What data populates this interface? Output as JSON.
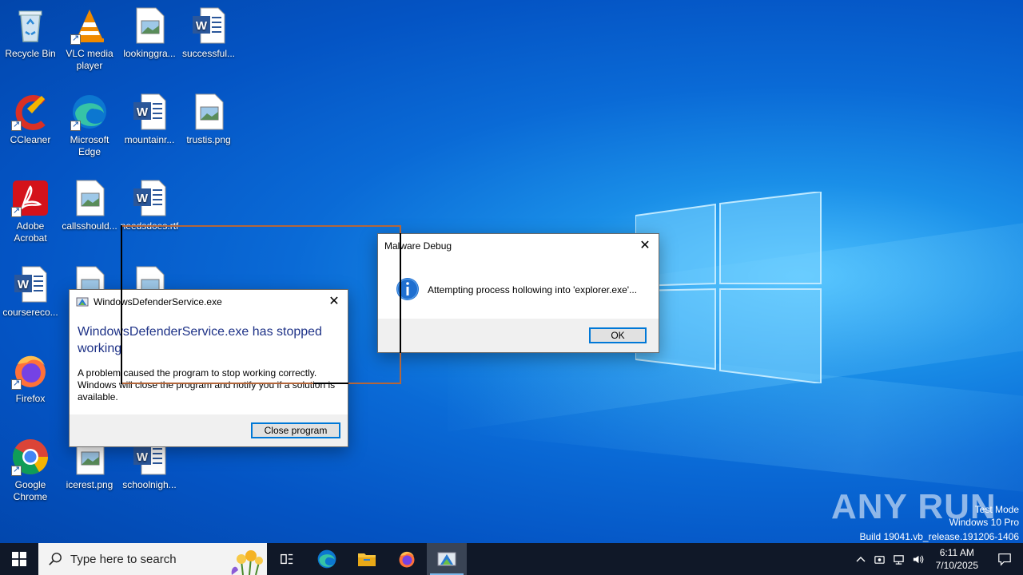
{
  "desktop": {
    "icons": [
      {
        "label": "Recycle Bin",
        "icon": "recycle-bin-icon"
      },
      {
        "label": "VLC media player",
        "icon": "vlc-icon"
      },
      {
        "label": "lookinggra...",
        "icon": "image-file-icon"
      },
      {
        "label": "successful...",
        "icon": "word-doc-icon"
      },
      {
        "label": "CCleaner",
        "icon": "ccleaner-icon"
      },
      {
        "label": "Microsoft Edge",
        "icon": "edge-icon"
      },
      {
        "label": "mountainr...",
        "icon": "word-doc-icon"
      },
      {
        "label": "trustis.png",
        "icon": "image-file-icon"
      },
      {
        "label": "Adobe Acrobat",
        "icon": "acrobat-icon"
      },
      {
        "label": "callsshould...",
        "icon": "image-file-icon"
      },
      {
        "label": "needsdoes.rtf",
        "icon": "word-doc-icon"
      },
      {
        "label": "coursereco...",
        "icon": "word-doc-icon"
      },
      {
        "label": "Firefox",
        "icon": "firefox-icon"
      },
      {
        "label": "Google Chrome",
        "icon": "chrome-icon"
      },
      {
        "label": "icerest.png",
        "icon": "image-file-icon"
      },
      {
        "label": "schoolnigh...",
        "icon": "word-doc-icon"
      }
    ]
  },
  "crash_dialog": {
    "title": "WindowsDefenderService.exe",
    "heading": "WindowsDefenderService.exe has stopped working",
    "message": "A problem caused the program to stop working correctly. Windows will close the program and notify you if a solution is available.",
    "button": "Close program"
  },
  "malware_dialog": {
    "title": "Malware Debug",
    "message": "Attempting process hollowing into 'explorer.exe'...",
    "button": "OK"
  },
  "watermark": {
    "line1": "Test Mode",
    "line2": "Windows 10 Pro",
    "line3": "Build 19041.vb_release.191206-1406",
    "brand": "ANY RUN"
  },
  "taskbar": {
    "search_placeholder": "Type here to search",
    "time": "6:11 AM",
    "date": "7/10/2025"
  },
  "colors": {
    "accent": "#0078d7",
    "heading_blue": "#1e3287",
    "taskbar": "#101828"
  }
}
